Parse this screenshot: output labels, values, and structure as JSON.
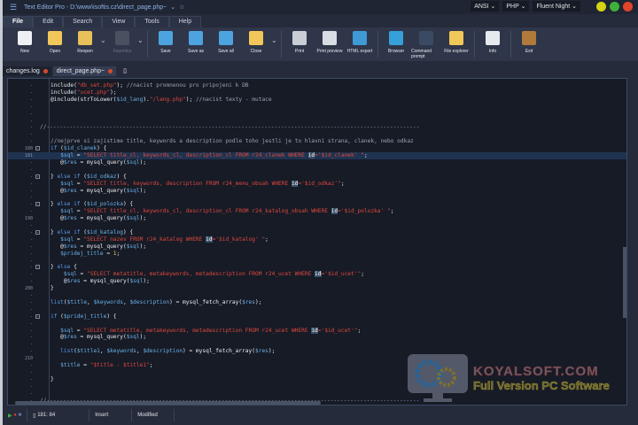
{
  "window": {
    "title": "Text Editor Pro - D:\\www\\isoftis.cz\\direct_page.php~",
    "encoding": "ANSI",
    "language": "PHP",
    "theme": "Fluent Night",
    "controls": [
      {
        "name": "minimize",
        "color": "#d4d414"
      },
      {
        "name": "maximize",
        "color": "#3fb13a"
      },
      {
        "name": "close",
        "color": "#e2452a"
      }
    ]
  },
  "menu": {
    "tabs": [
      "File",
      "Edit",
      "Search",
      "View",
      "Tools",
      "Help"
    ],
    "active": "File"
  },
  "ribbon": {
    "buttons": [
      {
        "label": "New",
        "icon": "new-file-icon",
        "color": "#eef0f4"
      },
      {
        "label": "Open",
        "icon": "open-folder-icon",
        "color": "#f1c75a"
      },
      {
        "label": "Reopen",
        "icon": "reopen-icon",
        "color": "#e9c05a",
        "dropdown": true
      },
      {
        "label": "Favorites",
        "icon": "favorites-icon",
        "color": "#4a5060",
        "disabled": true,
        "dropdown": true
      },
      {
        "label": "Save",
        "icon": "save-icon",
        "color": "#4da3df"
      },
      {
        "label": "Save as",
        "icon": "save-as-icon",
        "color": "#4da3df"
      },
      {
        "label": "Save all",
        "icon": "save-all-icon",
        "color": "#4da3df"
      },
      {
        "label": "Close",
        "icon": "close-folder-icon",
        "color": "#f1c75a",
        "dropdown": true
      },
      {
        "label": "Print",
        "icon": "print-icon",
        "color": "#c9ced6"
      },
      {
        "label": "Print preview",
        "icon": "print-preview-icon",
        "color": "#d8dde4"
      },
      {
        "label": "HTML export",
        "icon": "html-export-icon",
        "color": "#3f9ad6"
      },
      {
        "label": "Browser",
        "icon": "browser-globe-icon",
        "color": "#36a0d8"
      },
      {
        "label": "Command prompt",
        "icon": "command-prompt-icon",
        "color": "#3a4a62"
      },
      {
        "label": "File explorer",
        "icon": "file-explorer-icon",
        "color": "#f1c75a"
      },
      {
        "label": "Info",
        "icon": "info-icon",
        "color": "#e6e9ee"
      },
      {
        "label": "Exit",
        "icon": "exit-door-icon",
        "color": "#b07a3a"
      }
    ]
  },
  "doc_tabs": [
    {
      "label": "changes.log",
      "modified": true
    },
    {
      "label": "direct_page.php~",
      "modified": true,
      "active": true
    }
  ],
  "editor": {
    "current_line": 181,
    "lines": [
      {
        "n": 171,
        "t": [
          [
            "f",
            "include("
          ],
          [
            "s",
            "\"db_set.php\""
          ],
          [
            "f",
            ");"
          ],
          [
            "c",
            " //nacist promnenou pro pripojeni k DB"
          ]
        ]
      },
      {
        "n": 172,
        "t": [
          [
            "f",
            "include("
          ],
          [
            "s",
            "\"ucet.php\""
          ],
          [
            "f",
            ");"
          ]
        ]
      },
      {
        "n": 173,
        "t": [
          [
            "f",
            "@include(strToLower("
          ],
          [
            "v",
            "$id_lang"
          ],
          [
            "f",
            ")."
          ],
          [
            "s",
            "\"/lang.php\""
          ],
          [
            "f",
            ");"
          ],
          [
            "c",
            " //nacist texty - mutace"
          ]
        ]
      },
      {
        "n": 174,
        "t": []
      },
      {
        "n": 175,
        "t": []
      },
      {
        "n": 176,
        "t": []
      },
      {
        "n": 177,
        "t": [
          [
            "c",
            "//-----------------------------------------------------------------------------------------------------------------"
          ]
        ],
        "outdent": true
      },
      {
        "n": 178,
        "t": []
      },
      {
        "n": 179,
        "t": [
          [
            "c",
            "//nejprve si zajistime title, keywords a description podle toho jestli je to hlavni strana, clanek, nebo odkaz"
          ]
        ]
      },
      {
        "n": 180,
        "fold": true,
        "t": [
          [
            "k",
            "if"
          ],
          [
            "f",
            " ("
          ],
          [
            "v",
            "$id_clanek"
          ],
          [
            "f",
            ") {"
          ]
        ]
      },
      {
        "n": 181,
        "t": [
          [
            "v",
            "   $sql"
          ],
          [
            "f",
            " = "
          ],
          [
            "s",
            "\"SELECT title_cl, keywords_cl, description_cl FROM r24_clanek WHERE "
          ],
          [
            "h",
            "id"
          ],
          [
            "s",
            "='$id_clanek' \""
          ],
          [
            "f",
            ";"
          ]
        ]
      },
      {
        "n": 182,
        "t": [
          [
            "f",
            "   @"
          ],
          [
            "v",
            "$res"
          ],
          [
            "f",
            " = mysql_query("
          ],
          [
            "v",
            "$sql"
          ],
          [
            "f",
            ");"
          ]
        ]
      },
      {
        "n": 183,
        "t": []
      },
      {
        "n": 184,
        "fold": true,
        "t": [
          [
            "f",
            "} "
          ],
          [
            "k",
            "else if"
          ],
          [
            "f",
            " ("
          ],
          [
            "v",
            "$id_odkaz"
          ],
          [
            "f",
            ") {"
          ]
        ]
      },
      {
        "n": 185,
        "t": [
          [
            "v",
            "   $sql"
          ],
          [
            "f",
            " = "
          ],
          [
            "s",
            "\"SELECT title, keywords, description FROM r24_menu_obsah WHERE "
          ],
          [
            "h",
            "id"
          ],
          [
            "s",
            "='$id_odkaz'\""
          ],
          [
            "f",
            ";"
          ]
        ]
      },
      {
        "n": 186,
        "t": [
          [
            "f",
            "   @"
          ],
          [
            "v",
            "$res"
          ],
          [
            "f",
            " = mysql_query("
          ],
          [
            "v",
            "$sql"
          ],
          [
            "f",
            ");"
          ]
        ]
      },
      {
        "n": 187,
        "t": []
      },
      {
        "n": 188,
        "fold": true,
        "t": [
          [
            "f",
            "} "
          ],
          [
            "k",
            "else if"
          ],
          [
            "f",
            " ("
          ],
          [
            "v",
            "$id_polozka"
          ],
          [
            "f",
            ") {"
          ]
        ]
      },
      {
        "n": 189,
        "t": [
          [
            "v",
            "   $sql"
          ],
          [
            "f",
            " = "
          ],
          [
            "s",
            "\"SELECT title_cl, keywords_cl, description_cl FROM r24_katalog_obsah WHERE "
          ],
          [
            "h",
            "id"
          ],
          [
            "s",
            "='$id_polozka' \""
          ],
          [
            "f",
            ";"
          ]
        ]
      },
      {
        "n": 190,
        "t": [
          [
            "f",
            "   @"
          ],
          [
            "v",
            "$res"
          ],
          [
            "f",
            " = mysql_query("
          ],
          [
            "v",
            "$sql"
          ],
          [
            "f",
            ");"
          ]
        ]
      },
      {
        "n": 191,
        "t": []
      },
      {
        "n": 192,
        "fold": true,
        "t": [
          [
            "f",
            "} "
          ],
          [
            "k",
            "else if"
          ],
          [
            "f",
            " ("
          ],
          [
            "v",
            "$id_katalog"
          ],
          [
            "f",
            ") {"
          ]
        ]
      },
      {
        "n": 193,
        "t": [
          [
            "v",
            "   $sql"
          ],
          [
            "f",
            " = "
          ],
          [
            "s",
            "\"SELECT nazev FROM r24_katalog WHERE "
          ],
          [
            "h",
            "id"
          ],
          [
            "s",
            "='$id_katalog' \""
          ],
          [
            "f",
            ";"
          ]
        ]
      },
      {
        "n": 194,
        "t": [
          [
            "f",
            "   @"
          ],
          [
            "v",
            "$res"
          ],
          [
            "f",
            " = mysql_query("
          ],
          [
            "v",
            "$sql"
          ],
          [
            "f",
            ");"
          ]
        ]
      },
      {
        "n": 195,
        "t": [
          [
            "v",
            "   $pridej_title"
          ],
          [
            "f",
            " = "
          ],
          [
            "n",
            "1"
          ],
          [
            "f",
            ";"
          ]
        ]
      },
      {
        "n": 196,
        "t": []
      },
      {
        "n": 197,
        "fold": true,
        "t": [
          [
            "f",
            "} "
          ],
          [
            "k",
            "else"
          ],
          [
            "f",
            " {"
          ]
        ]
      },
      {
        "n": 198,
        "t": [
          [
            "v",
            "    $sql"
          ],
          [
            "f",
            " = "
          ],
          [
            "s",
            "\"SELECT metatitle, metakeywords, metadescription FROM r24_ucet WHERE "
          ],
          [
            "h",
            "id"
          ],
          [
            "s",
            "='$id_ucet'\""
          ],
          [
            "f",
            ";"
          ]
        ]
      },
      {
        "n": 199,
        "t": [
          [
            "f",
            "    @"
          ],
          [
            "v",
            "$res"
          ],
          [
            "f",
            " = mysql_query("
          ],
          [
            "v",
            "$sql"
          ],
          [
            "f",
            ");"
          ]
        ]
      },
      {
        "n": 200,
        "t": [
          [
            "f",
            "}"
          ]
        ]
      },
      {
        "n": 201,
        "t": []
      },
      {
        "n": 202,
        "t": [
          [
            "k",
            "list"
          ],
          [
            "f",
            "("
          ],
          [
            "v",
            "$title"
          ],
          [
            "f",
            ", "
          ],
          [
            "v",
            "$keywords"
          ],
          [
            "f",
            ", "
          ],
          [
            "v",
            "$description"
          ],
          [
            "f",
            ") = mysql_fetch_array("
          ],
          [
            "v",
            "$res"
          ],
          [
            "f",
            ");"
          ]
        ]
      },
      {
        "n": 203,
        "t": []
      },
      {
        "n": 204,
        "fold": true,
        "t": [
          [
            "k",
            "if"
          ],
          [
            "f",
            " ("
          ],
          [
            "v",
            "$pridej_title"
          ],
          [
            "f",
            ") {"
          ]
        ]
      },
      {
        "n": 205,
        "t": []
      },
      {
        "n": 206,
        "t": [
          [
            "v",
            "   $sql"
          ],
          [
            "f",
            " = "
          ],
          [
            "s",
            "\"SELECT metatitle, metakeywords, metadescription FROM r24_ucet WHERE "
          ],
          [
            "h",
            "id"
          ],
          [
            "s",
            "='$id_ucet'\""
          ],
          [
            "f",
            ";"
          ]
        ]
      },
      {
        "n": 207,
        "t": [
          [
            "f",
            "   @"
          ],
          [
            "v",
            "$res"
          ],
          [
            "f",
            " = mysql_query("
          ],
          [
            "v",
            "$sql"
          ],
          [
            "f",
            ");"
          ]
        ]
      },
      {
        "n": 208,
        "t": []
      },
      {
        "n": 209,
        "t": [
          [
            "k",
            "   list"
          ],
          [
            "f",
            "("
          ],
          [
            "v",
            "$title1"
          ],
          [
            "f",
            ", "
          ],
          [
            "v",
            "$keywords"
          ],
          [
            "f",
            ", "
          ],
          [
            "v",
            "$description"
          ],
          [
            "f",
            ") = mysql_fetch_array("
          ],
          [
            "v",
            "$res"
          ],
          [
            "f",
            ");"
          ]
        ]
      },
      {
        "n": 210,
        "t": []
      },
      {
        "n": 211,
        "t": [
          [
            "v",
            "   $title"
          ],
          [
            "f",
            " = "
          ],
          [
            "s",
            "\"$title - $title1\""
          ],
          [
            "f",
            ";"
          ]
        ]
      },
      {
        "n": 212,
        "t": []
      },
      {
        "n": 213,
        "t": [
          [
            "f",
            "}"
          ]
        ]
      },
      {
        "n": 214,
        "t": []
      },
      {
        "n": 215,
        "t": []
      },
      {
        "n": 216,
        "t": [
          [
            "c",
            "//-----------------------------------------------------------------------------------------------------------------"
          ]
        ],
        "outdent": true
      }
    ]
  },
  "status": {
    "position": "181: 84",
    "mode": "Insert",
    "state": "Modified"
  },
  "watermark": {
    "line1": "KoyalSoft.com",
    "line2": "Full Version PC Software"
  }
}
